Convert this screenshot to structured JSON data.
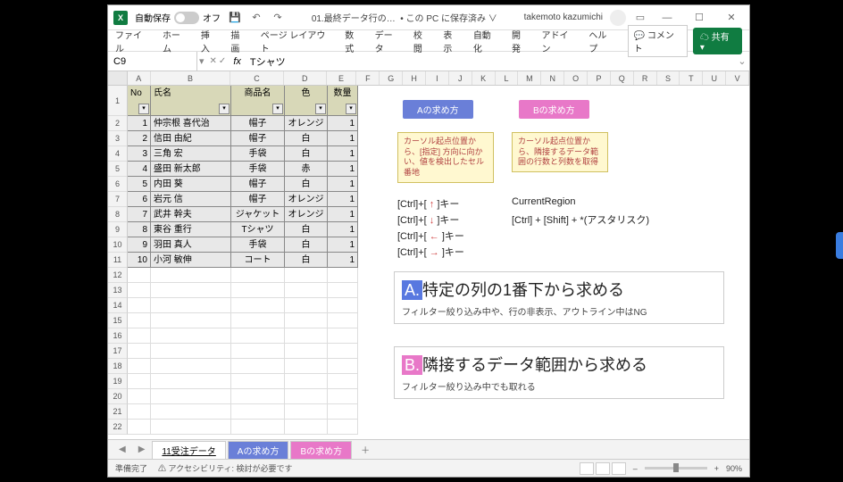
{
  "titlebar": {
    "autosave_label": "自動保存",
    "autosave_state": "オフ",
    "filename": "01.最終データ行の…",
    "saved_location": "• この PC に保存済み ∨",
    "user": "takemoto kazumichi"
  },
  "ribbon": {
    "tabs": [
      "ファイル",
      "ホーム",
      "挿入",
      "描画",
      "ページ レイアウト",
      "数式",
      "データ",
      "校閲",
      "表示",
      "自動化",
      "開発",
      "アドイン",
      "ヘルプ"
    ],
    "comment": "コメント",
    "share": "共有"
  },
  "formula": {
    "namebox": "C9",
    "value": "Tシャツ"
  },
  "columns": [
    "A",
    "B",
    "C",
    "D",
    "E",
    "F",
    "G",
    "H",
    "I",
    "J",
    "K",
    "L",
    "M",
    "N",
    "O",
    "P",
    "Q",
    "R",
    "S",
    "T",
    "U",
    "V"
  ],
  "table": {
    "headers": {
      "no": "No",
      "name": "氏名",
      "product": "商品名",
      "color": "色",
      "qty": "数量"
    },
    "rows": [
      {
        "no": 1,
        "name": "仲宗根 喜代治",
        "product": "帽子",
        "color": "オレンジ",
        "qty": 1
      },
      {
        "no": 2,
        "name": "信田 由紀",
        "product": "帽子",
        "color": "白",
        "qty": 1
      },
      {
        "no": 3,
        "name": "三角 宏",
        "product": "手袋",
        "color": "白",
        "qty": 1
      },
      {
        "no": 4,
        "name": "盛田 新太郎",
        "product": "手袋",
        "color": "赤",
        "qty": 1
      },
      {
        "no": 5,
        "name": "内田 葵",
        "product": "帽子",
        "color": "白",
        "qty": 1
      },
      {
        "no": 6,
        "name": "岩元 信",
        "product": "帽子",
        "color": "オレンジ",
        "qty": 1
      },
      {
        "no": 7,
        "name": "武井 幹夫",
        "product": "ジャケット",
        "color": "オレンジ",
        "qty": 1
      },
      {
        "no": 8,
        "name": "東谷 重行",
        "product": "Tシャツ",
        "color": "白",
        "qty": 1
      },
      {
        "no": 9,
        "name": "羽田 真人",
        "product": "手袋",
        "color": "白",
        "qty": 1
      },
      {
        "no": 10,
        "name": "小河 敏伸",
        "product": "コート",
        "color": "白",
        "qty": 1
      }
    ]
  },
  "buttons": {
    "a": "Aの求め方",
    "b": "Bの求め方"
  },
  "notes": {
    "a": "カーソル起点位置から、[指定] 方向に向かい、値を検出したセル番地",
    "b": "カーソル起点位置から、隣接するデータ範囲の行数と列数を取得"
  },
  "keys": {
    "up": "[Ctrl]+[ ↑ ]キー",
    "down": "[Ctrl]+[ ↓ ]キー",
    "left": "[Ctrl]+[ ← ]キー",
    "right": "[Ctrl]+[ → ]キー",
    "region": "CurrentRegion",
    "region_key": "[Ctrl] + [Shift] + *(アスタリスク)"
  },
  "sections": {
    "a_title": "特定の列の1番下から求める",
    "a_sub": "フィルター絞り込み中や、行の非表示、アウトライン中はNG",
    "b_title": "隣接するデータ範囲から求める",
    "b_sub": "フィルター絞り込み中でも取れる"
  },
  "sheets": {
    "s1": "11受注データ",
    "s2": "Aの求め方",
    "s3": "Bの求め方"
  },
  "status": {
    "ready": "準備完了",
    "access": "アクセシビリティ: 検討が必要です",
    "zoom": "90%"
  }
}
